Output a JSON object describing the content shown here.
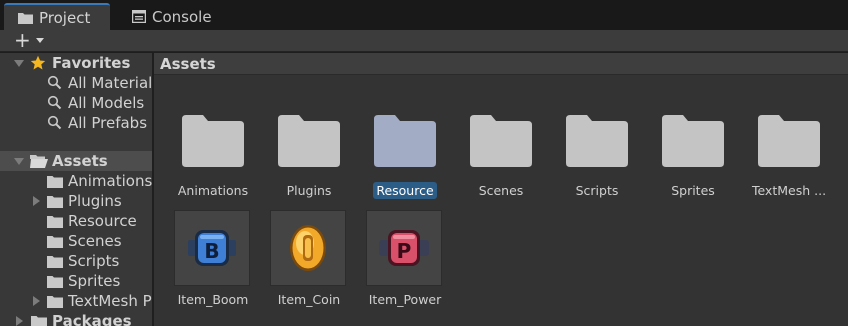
{
  "tabs": [
    {
      "label": "Project",
      "icon": "folder-icon",
      "active": true
    },
    {
      "label": "Console",
      "icon": "console-icon",
      "active": false
    }
  ],
  "toolbar": {
    "create_label": "+"
  },
  "sidebar": {
    "favorites": {
      "label": "Favorites",
      "items": [
        "All Materials",
        "All Models",
        "All Prefabs"
      ]
    },
    "assets": {
      "label": "Assets",
      "items": [
        "Animations",
        "Plugins",
        "Resource",
        "Scenes",
        "Scripts",
        "Sprites",
        "TextMesh Pro"
      ]
    },
    "packages": {
      "label": "Packages"
    }
  },
  "main": {
    "breadcrumb": "Assets",
    "folders": [
      "Animations",
      "Plugins",
      "Resource",
      "Scenes",
      "Scripts",
      "Sprites",
      "TextMesh ..."
    ],
    "selected_folder": "Resource",
    "assets": [
      {
        "name": "Item_Boom",
        "letter": "B",
        "color": "#3f7fd6"
      },
      {
        "name": "Item_Coin",
        "letter": "0",
        "color": "#f2a92a"
      },
      {
        "name": "Item_Power",
        "letter": "P",
        "color": "#d9506a"
      }
    ]
  },
  "colors": {
    "accent": "#3a79bb",
    "folder": "#c4c4c4",
    "folder_selected": "#a2acc4",
    "selection": "#2c5d87"
  }
}
